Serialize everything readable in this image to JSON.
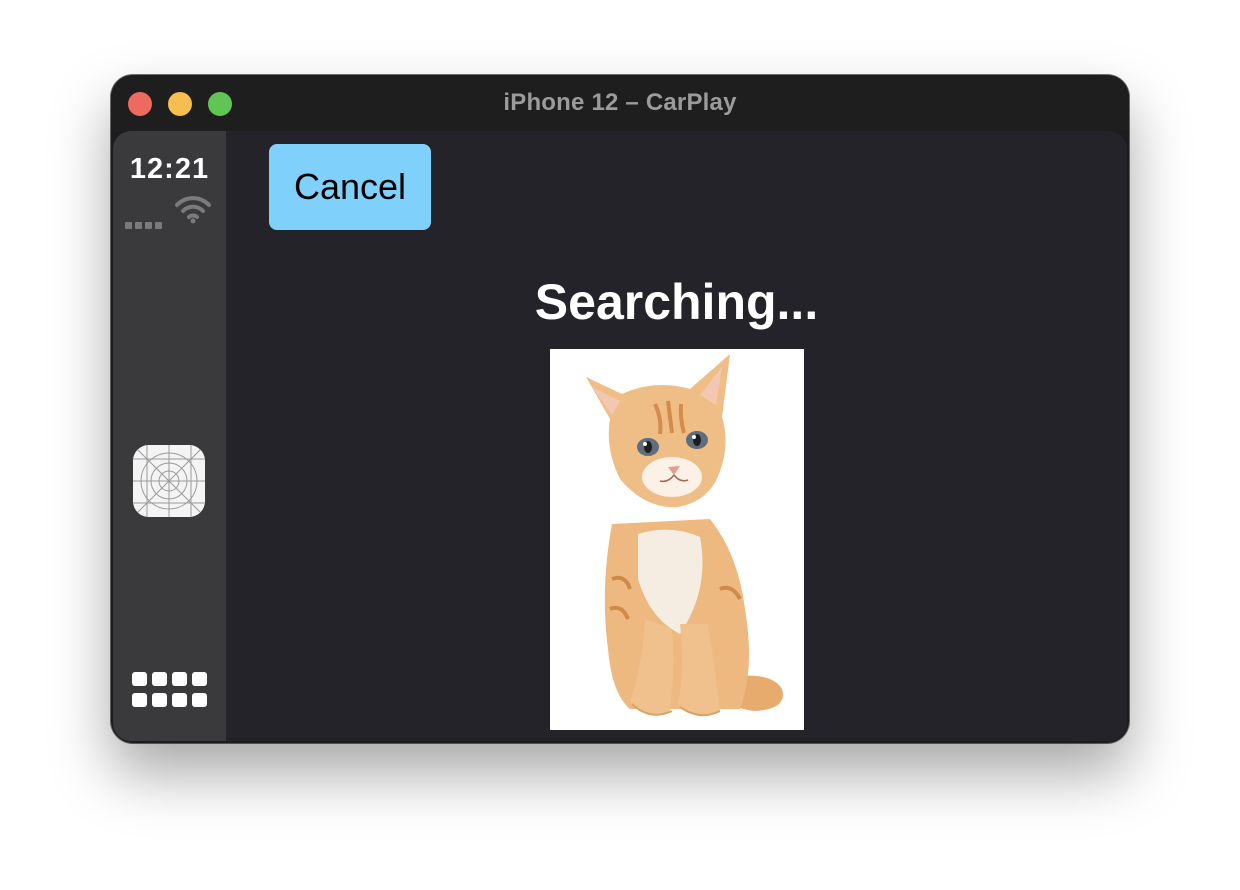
{
  "window": {
    "title": "iPhone 12 – CarPlay"
  },
  "status": {
    "time": "12:21"
  },
  "sidebar": {
    "app_icon": "app-placeholder-icon",
    "home_icon": "app-grid-icon"
  },
  "main": {
    "cancel_label": "Cancel",
    "heading": "Searching...",
    "image": "orange-kitten-photo"
  },
  "colors": {
    "window_bg": "#1c1c1e",
    "screen_bg": "#242329",
    "sidebar_bg": "#3a3a3d",
    "cancel_bg": "#7fd0fb",
    "traffic_red": "#ed6a5e",
    "traffic_yellow": "#f5be4f",
    "traffic_green": "#61c554"
  }
}
